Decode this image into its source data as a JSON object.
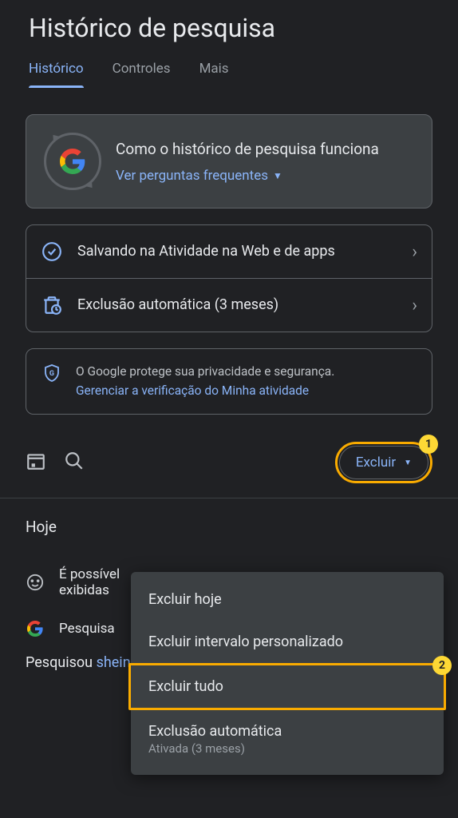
{
  "page_title": "Histórico de pesquisa",
  "tabs": [
    {
      "label": "Histórico",
      "active": true
    },
    {
      "label": "Controles",
      "active": false
    },
    {
      "label": "Mais",
      "active": false
    }
  ],
  "info_card": {
    "title": "Como o histórico de pesquisa funciona",
    "link": "Ver perguntas frequentes"
  },
  "settings": [
    {
      "icon": "checkmark-circle",
      "text": "Salvando na Atividade na Web e de apps"
    },
    {
      "icon": "auto-delete",
      "text": "Exclusão automática (3 meses)"
    }
  ],
  "privacy": {
    "text": "O Google protege sua privacidade e segurança.",
    "link": "Gerenciar a verificação do Minha atividade"
  },
  "toolbar": {
    "delete_label": "Excluir"
  },
  "section_header": "Hoje",
  "history": [
    {
      "icon": "smiley",
      "text": "É possível"
    },
    {
      "icon": "smiley",
      "text": "exibidas",
      "continued": true
    },
    {
      "icon": "google",
      "text": "Pesquisa"
    }
  ],
  "history_line1": "É possível",
  "history_line2": "exibidas",
  "history_line3": "Pesquisa",
  "search_row": {
    "prefix": "Pesquisou ",
    "term": "shein"
  },
  "delete_menu": [
    {
      "label": "Excluir hoje"
    },
    {
      "label": "Excluir intervalo personalizado"
    },
    {
      "label": "Excluir tudo",
      "highlighted": true
    },
    {
      "label": "Exclusão automática",
      "sub": "Ativada (3 meses)"
    }
  ],
  "annotations": {
    "badge1": "1",
    "badge2": "2"
  }
}
